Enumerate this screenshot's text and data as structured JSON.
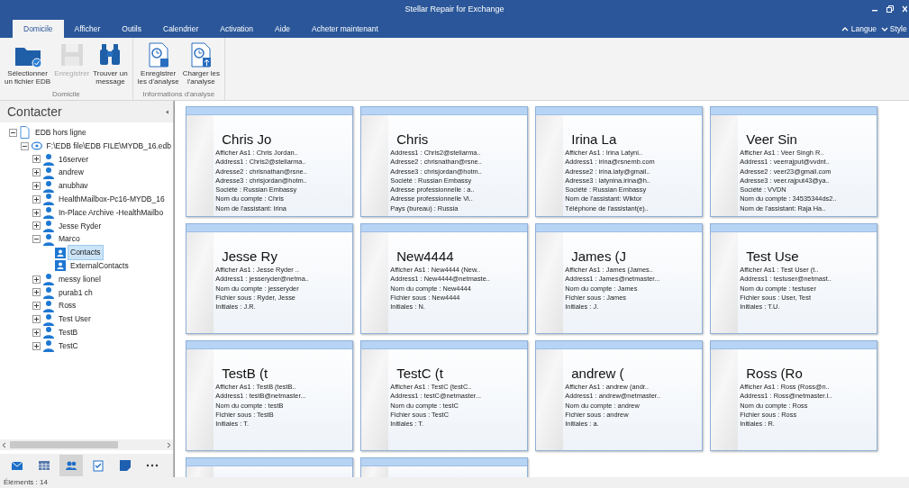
{
  "window": {
    "title": "Stellar Repair for Exchange"
  },
  "tabs": [
    {
      "label": "Domicile",
      "selected": true
    },
    {
      "label": "Afficher",
      "selected": false
    },
    {
      "label": "Outils",
      "selected": false
    },
    {
      "label": "Calendrier",
      "selected": false
    },
    {
      "label": "Activation",
      "selected": false
    },
    {
      "label": "Aide",
      "selected": false
    },
    {
      "label": "Acheter maintenant",
      "selected": false
    }
  ],
  "ribbon_right": [
    {
      "label": "Langue",
      "kind": "up"
    },
    {
      "label": "Style",
      "kind": "down"
    }
  ],
  "ribbon_groups": [
    {
      "label": "Domicile",
      "buttons": [
        {
          "kind": "folder",
          "label": "Sélectionner\nun fichier EDB",
          "disabled": false
        },
        {
          "kind": "save",
          "label": "Enregistrer",
          "disabled": true
        },
        {
          "kind": "binoculars",
          "label": "Trouver un\nmessage",
          "disabled": false
        }
      ]
    },
    {
      "label": "Informations d'analyse",
      "buttons": [
        {
          "kind": "save-scan",
          "label": "Enregistrer\nles d'analyse",
          "disabled": false
        },
        {
          "kind": "load-scan",
          "label": "Charger les\nl'analyse",
          "disabled": false
        }
      ]
    }
  ],
  "sidebar": {
    "title": "Contacter",
    "tree": [
      {
        "label": "EDB hors ligne",
        "kind": "document",
        "expanded": true,
        "selected": false,
        "children": [
          {
            "label": "F:\\EDB file\\EDB FILE\\MYDB_16.edb",
            "kind": "database",
            "expanded": true,
            "selected": false,
            "children": [
              {
                "label": "16server",
                "kind": "user",
                "expanded": false,
                "selected": false
              },
              {
                "label": "andrew",
                "kind": "user",
                "expanded": false,
                "selected": false
              },
              {
                "label": "anubhav",
                "kind": "user",
                "expanded": false,
                "selected": false
              },
              {
                "label": "HealthMailbox-Pc16-MYDB_16",
                "kind": "user",
                "expanded": false,
                "selected": false
              },
              {
                "label": "In-Place Archive -HealthMailbo",
                "kind": "user",
                "expanded": false,
                "selected": false
              },
              {
                "label": "Jesse Ryder",
                "kind": "user",
                "expanded": false,
                "selected": false
              },
              {
                "label": "Marco",
                "kind": "user",
                "expanded": true,
                "selected": false,
                "children": [
                  {
                    "label": "Contacts",
                    "kind": "contacts",
                    "selected": true
                  },
                  {
                    "label": "ExternalContacts",
                    "kind": "contacts",
                    "selected": false
                  }
                ]
              },
              {
                "label": "messy lionel",
                "kind": "user",
                "expanded": false,
                "selected": false
              },
              {
                "label": "purab1 ch",
                "kind": "user",
                "expanded": false,
                "selected": false
              },
              {
                "label": "Ross",
                "kind": "user",
                "expanded": false,
                "selected": false
              },
              {
                "label": "Test User",
                "kind": "user",
                "expanded": false,
                "selected": false
              },
              {
                "label": "TestB",
                "kind": "user",
                "expanded": false,
                "selected": false
              },
              {
                "label": "TestC",
                "kind": "user",
                "expanded": false,
                "selected": false
              }
            ]
          }
        ]
      }
    ]
  },
  "nav": [
    {
      "kind": "mail",
      "selected": false
    },
    {
      "kind": "calendar",
      "selected": false
    },
    {
      "kind": "contacts",
      "selected": true
    },
    {
      "kind": "tasks",
      "selected": false
    },
    {
      "kind": "notes",
      "selected": false
    },
    {
      "kind": "more",
      "selected": false
    }
  ],
  "cards": [
    {
      "name": "Chris Jo",
      "fields": [
        "Afficher As1 : Chris Jordan..",
        "Address1 : Chris2@stellarma..",
        "Adresse2 : chrisnathan@rsne..",
        "Adresse3 : chrisjordan@hotm..",
        "Société : Russian Embassy",
        "Nom du compte : Chris",
        "Nom de l'assistant: Irina"
      ]
    },
    {
      "name": "Chris",
      "fields": [
        "Address1 : Chris2@stellarma..",
        "Adresse2 : chrisnathan@rsne..",
        "Adresse3 : chrisjordan@hotm..",
        "Société : Russian Embassy",
        "Adresse professionnelle : a..",
        "Adresse professionnelle Vi..",
        "Pays (bureau) : Russia"
      ]
    },
    {
      "name": "Irina La",
      "fields": [
        "Afficher As1 : Irina Latyni..",
        "Address1 : irina@rsnemb.com",
        "Adresse2 : irina.laty@gmail..",
        "Adresse3 : latynina.irina@h..",
        "Société : Russian Embassy",
        "Nom de l'assistant: Wiktor",
        "Téléphone de l'assistant(e).."
      ]
    },
    {
      "name": "Veer Sin",
      "fields": [
        "Afficher As1 : Veer Singh R..",
        "Address1 : veerrajput@vvdnt..",
        "Adresse2 : veer23@gmail.com",
        "Adresse3 : veer.rajput43@ya..",
        "Société : VVDN",
        "Nom du compte : 34535344ds2..",
        "Nom de l'assistant: Raja Ha.."
      ]
    },
    {
      "name": "Jesse Ry",
      "fields": [
        "Afficher As1 : Jesse Ryder ..",
        "Address1 : jesseryder@netma..",
        "Nom du compte : jesseryder",
        "Fichier sous : Ryder, Jesse",
        "Initiales : J.R."
      ]
    },
    {
      "name": "New4444",
      "fields": [
        "Afficher As1 : New4444 (New..",
        "Address1 : New4444@netmaste..",
        "Nom du compte : New4444",
        "Fichier sous : New4444",
        "Initiales : N."
      ]
    },
    {
      "name": "James (J",
      "fields": [
        "Afficher As1 : James (James..",
        "Address1 : James@netmaster...",
        "Nom du compte : James",
        "Fichier sous : James",
        "Initiales : J."
      ]
    },
    {
      "name": "Test Use",
      "fields": [
        "Afficher As1 : Test User (t..",
        "Address1 : testuser@netmast..",
        "Nom du compte : testuser",
        "Fichier sous : User, Test",
        "Initiales : T.U."
      ]
    },
    {
      "name": "TestB (t",
      "fields": [
        "Afficher As1 : TestB (testB..",
        "Address1 : testB@netmaster...",
        "Nom du compte : testB",
        "Fichier sous : TestB",
        "Initiales : T."
      ]
    },
    {
      "name": "TestC (t",
      "fields": [
        "Afficher As1 : TestC (testC..",
        "Address1 : testC@netmaster...",
        "Nom du compte : testC",
        "Fichier sous : TestC",
        "Initiales : T."
      ]
    },
    {
      "name": "andrew (",
      "fields": [
        "Afficher As1 : andrew (andr..",
        "Address1 : andrew@netmaster..",
        "Nom du compte : andrew",
        "Fichier sous : andrew",
        "Initiales : a."
      ]
    },
    {
      "name": "Ross (Ro",
      "fields": [
        "Afficher As1 : Ross (Ross@n..",
        "Address1 : Ross@netmaster.l..",
        "Nom du compte : Ross",
        "Fichier sous : Ross",
        "Initiales : R."
      ]
    },
    {
      "partial": true
    },
    {
      "partial": true
    }
  ],
  "status_bar": {
    "text": "Éléments : 14"
  }
}
